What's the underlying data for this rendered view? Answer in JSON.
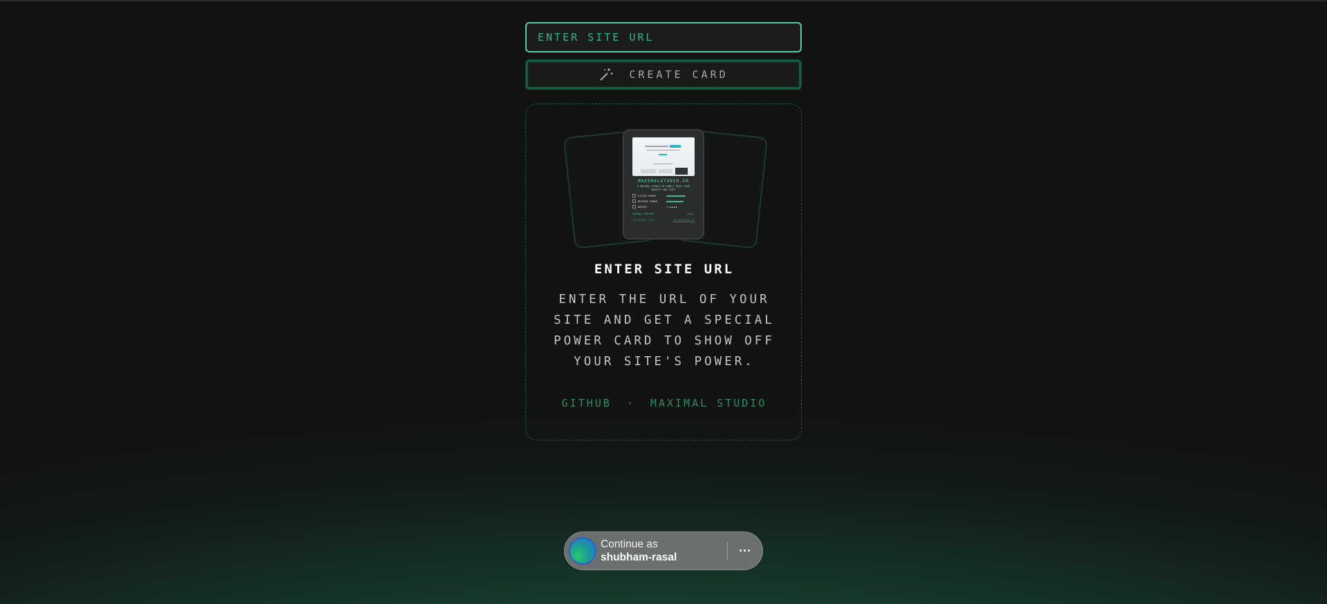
{
  "form": {
    "url_placeholder": "ENTER SITE URL",
    "url_value": "",
    "create_label": "CREATE CARD",
    "create_icon": "magic-wand-icon"
  },
  "preview_card": {
    "site": "MAXIMALSTUDIO.IN",
    "description": "A MAXIMAL STUDIO TO SIMPLY TRACK YOUR WEBSITE AND STUFF",
    "stats": [
      {
        "label": "ATTACK POWER",
        "value": 0.9
      },
      {
        "label": "DEFENCE POWER",
        "value": 0.85
      },
      {
        "label": "BADGES",
        "value": null
      }
    ],
    "rating_label": "OVERALL RATING",
    "rating_stars": 4,
    "footer_left": "FOR MAXIMAL SITES",
    "footer_right": "MAXIMALSTUDIO.IN"
  },
  "panel": {
    "title": "ENTER SITE URL",
    "description": "ENTER THE URL OF YOUR SITE AND GET A SPECIAL POWER CARD TO SHOW OFF YOUR SITE'S POWER.",
    "links": {
      "github": "GITHUB",
      "separator": "·",
      "studio": "MAXIMAL STUDIO"
    }
  },
  "signin": {
    "line1": "Continue as",
    "username": "shubham-rasal",
    "more": "···"
  },
  "colors": {
    "accent": "#4fd1a5",
    "accent_dark": "#165a3d",
    "background": "#121212"
  }
}
